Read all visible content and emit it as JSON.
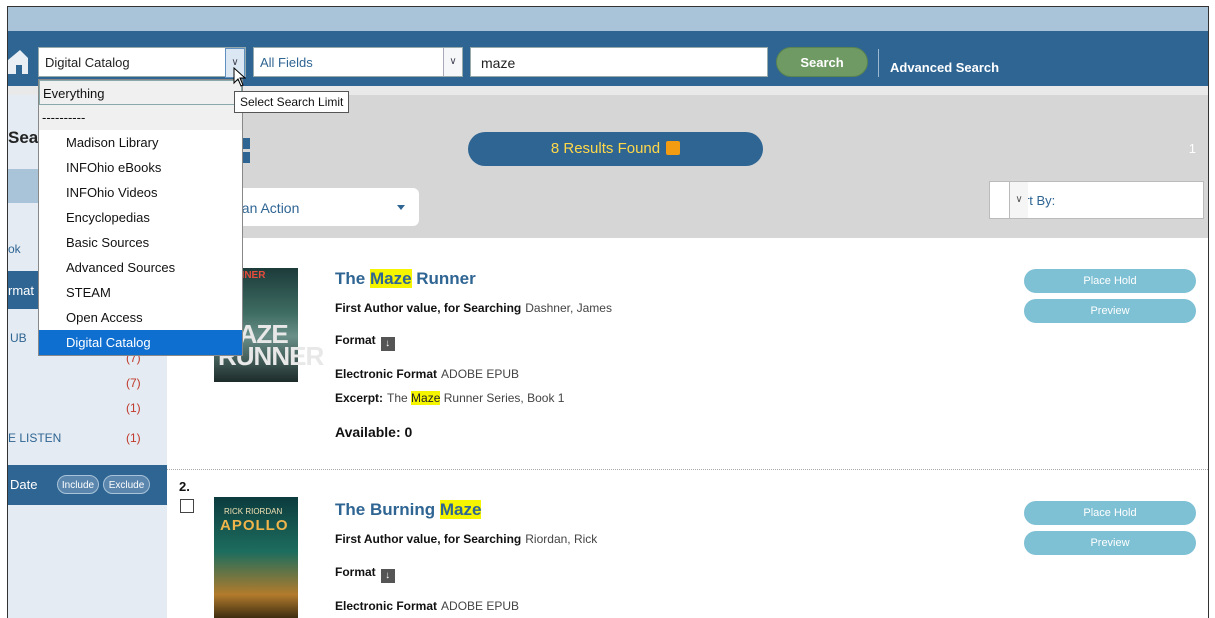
{
  "search": {
    "limit_selected": "Digital Catalog",
    "field_selected": "All Fields",
    "query": "maze",
    "search_button": "Search",
    "advanced_search": "Advanced Search",
    "tooltip": "Select Search Limit"
  },
  "limit_options": [
    "Everything",
    "----------",
    "Madison Library",
    "INFOhio eBooks",
    "INFOhio Videos",
    "Encyclopedias",
    "Basic Sources",
    "Advanced Sources",
    "STEAM",
    "Open Access",
    "Digital Catalog"
  ],
  "sidebar": {
    "heading_fragment": "Sear",
    "item_k": "ok",
    "format_fragment": "rmat",
    "ub_fragment": "UB",
    "counts": [
      "(7)",
      "(7)",
      "(1)",
      "(1)"
    ],
    "listen_fragment": "E LISTEN",
    "date_fragment": "Date",
    "include": "Include",
    "exclude": "Exclude"
  },
  "results_header": {
    "results_found": "8 Results Found",
    "page": "1",
    "action_fragment": "ct an Action",
    "sort_by": "Sort By:"
  },
  "results": [
    {
      "title_prefix": "The ",
      "title_highlight": "Maze",
      "title_suffix": " Runner",
      "author_label": "First Author value, for Searching",
      "author": "Dashner, James",
      "format_label": "Format",
      "eformat_label": "Electronic Format",
      "eformat": "ADOBE EPUB",
      "excerpt_label": "Excerpt:",
      "excerpt_prefix": "The ",
      "excerpt_highlight": "Maze",
      "excerpt_suffix": " Runner Series, Book 1",
      "available": "Available: 0",
      "place_hold": "Place Hold",
      "preview": "Preview",
      "cover_text_top": "DASHNER",
      "cover_text_main": "MAZE RUNNER"
    },
    {
      "number": "2.",
      "title_prefix": "The Burning ",
      "title_highlight": "Maze",
      "author_label": "First Author value, for Searching",
      "author": "Riordan, Rick",
      "format_label": "Format",
      "eformat_label": "Electronic Format",
      "eformat": "ADOBE EPUB",
      "place_hold": "Place Hold",
      "preview": "Preview",
      "cover_text_top": "RICK RIORDAN",
      "cover_text_main": "APOLLO"
    }
  ],
  "colors": {
    "primary": "#2f6593",
    "search_button": "#6f9a63",
    "highlight": "#f5f500",
    "pill": "#7ec0d4",
    "selected_option": "#0f6fd0"
  }
}
